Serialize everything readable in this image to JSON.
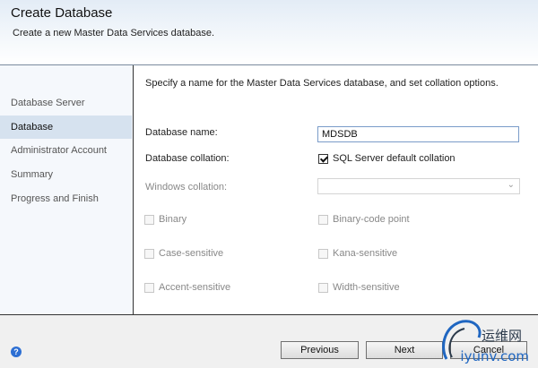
{
  "header": {
    "title": "Create Database",
    "subtitle": "Create a new Master Data Services database."
  },
  "sidebar": {
    "items": [
      {
        "label": "Database Server",
        "active": false
      },
      {
        "label": "Database",
        "active": true
      },
      {
        "label": "Administrator Account",
        "active": false
      },
      {
        "label": "Summary",
        "active": false
      },
      {
        "label": "Progress and Finish",
        "active": false
      }
    ]
  },
  "main": {
    "instruction": "Specify a name for the Master Data Services database, and set collation options.",
    "database_name_label": "Database name:",
    "database_name_value": "MDSDB",
    "database_collation_label": "Database collation:",
    "sql_default_collation": {
      "label": "SQL Server default collation",
      "checked": true
    },
    "windows_collation_label": "Windows collation:",
    "windows_collation_value": "",
    "options": {
      "binary": "Binary",
      "binary_code_point": "Binary-code point",
      "case_sensitive": "Case-sensitive",
      "kana_sensitive": "Kana-sensitive",
      "accent_sensitive": "Accent-sensitive",
      "width_sensitive": "Width-sensitive"
    }
  },
  "footer": {
    "help_icon": "help-icon",
    "previous_label": "Previous",
    "next_label": "Next",
    "cancel_label": "Cancel"
  },
  "watermark": {
    "cn": "运维网",
    "en": "iyunv.com"
  },
  "colors": {
    "sidebar_active": "#d6e2ef",
    "help_icon": "#2d6fd3",
    "watermark_blue": "#1f66c1"
  }
}
